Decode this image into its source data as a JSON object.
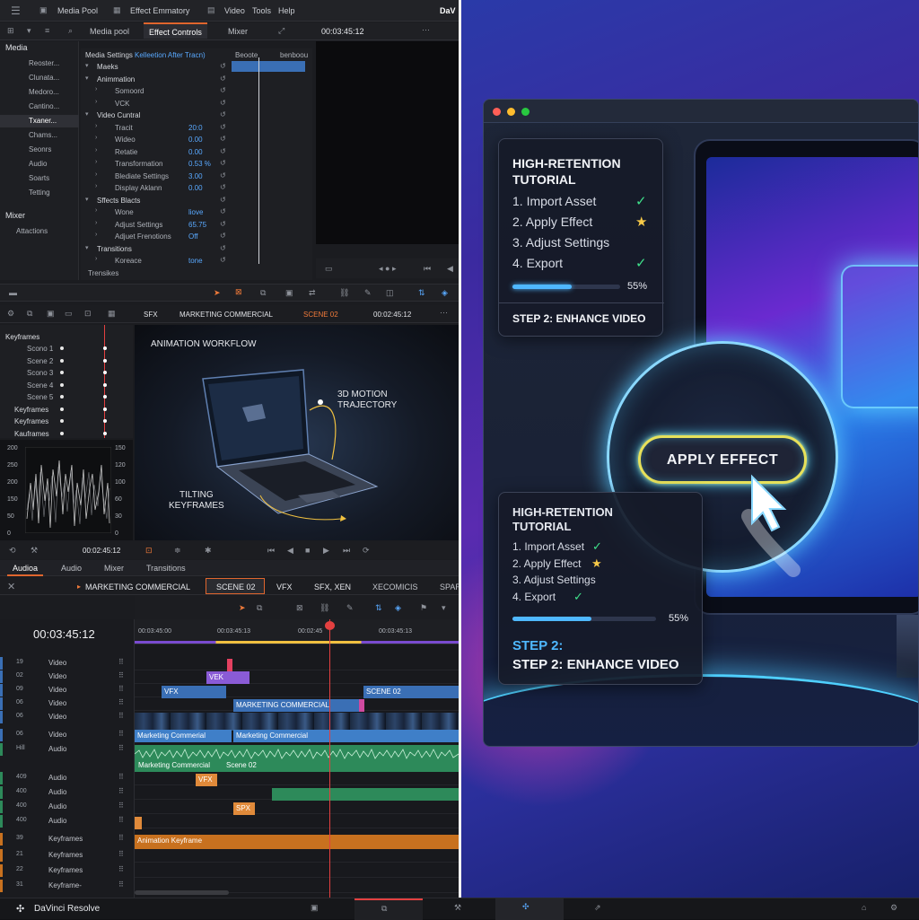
{
  "menubar": {
    "items": [
      "Media Pool",
      "Effect Emmatory",
      "Video",
      "Tools",
      "Help"
    ],
    "app": "DaV"
  },
  "top_tabs": {
    "items": [
      "Media pool",
      "Effect Controls",
      "Mixer"
    ],
    "timecode": "00:03:45:12"
  },
  "media_panel": {
    "header": "Media",
    "items": [
      "Reoster...",
      "Clunata...",
      "Medoro...",
      "Cantino...",
      "Txaner...",
      "Chams...",
      "Seonrs",
      "Audio",
      "Soarts",
      "Tetting"
    ],
    "mixer": "Mixer",
    "mixer_item": "Attactions"
  },
  "effect_controls": {
    "header": "Media Settings",
    "header_sub": "Kelleetion After Tracn)",
    "col2": "Beoote",
    "col3": "benboou",
    "rows": [
      {
        "label": "Maeks",
        "value": ""
      },
      {
        "label": "Animmation",
        "value": ""
      },
      {
        "label": "Somoord",
        "value": ""
      },
      {
        "label": "VCK",
        "value": ""
      },
      {
        "label": "Video Cuntral",
        "value": ""
      },
      {
        "label": "Tracit",
        "value": "20:0"
      },
      {
        "label": "Wideo",
        "value": "0.00"
      },
      {
        "label": "Retatie",
        "value": "0.00"
      },
      {
        "label": "Transformation",
        "value": "0.53 %"
      },
      {
        "label": "Blediate Settings",
        "value": "3.00"
      },
      {
        "label": "Display Aklann",
        "value": "0.00"
      },
      {
        "label": "Sffects Blacts",
        "value": ""
      },
      {
        "label": "Wone",
        "value": "liove"
      },
      {
        "label": "Adjust Settings",
        "value": "65.75"
      },
      {
        "label": "Adjuet Frenotions",
        "value": "Off"
      },
      {
        "label": "Transitions",
        "value": ""
      },
      {
        "label": "Koreace",
        "value": "tone"
      }
    ],
    "footer": "Trensikes"
  },
  "scene_bar": {
    "sfx": "SFX",
    "title": "MARKETING COMMERCIAL",
    "scene": "SCENE 02",
    "timecode": "00:02:45:12"
  },
  "keyframes_panel": {
    "header": "Keyframes",
    "items": [
      "Scono 1",
      "Scene 2",
      "Scono 3",
      "Scene 4",
      "Scene 5",
      "Keyframes",
      "Keyframes",
      "Kauframes"
    ]
  },
  "scope": {
    "left_ticks": [
      "200",
      "250",
      "200",
      "150",
      "50",
      "0"
    ],
    "right_ticks": [
      "150",
      "120",
      "100",
      "60",
      "30",
      "0"
    ]
  },
  "viewer": {
    "title": "ANIMATION WORKFLOW",
    "label_3d": "3D MOTION\nTRAJECTORY",
    "label_tilt": "TILTING\nKEYFRAMES",
    "timecode": "00:02:45:12"
  },
  "page_tabs": {
    "items": [
      "Audioa",
      "Audio",
      "Mixer",
      "Transitions"
    ]
  },
  "timeline_tabs": {
    "items": [
      "MARKETING COMMERCIAL",
      "SCENE 02",
      "VFX",
      "SFX, XEN",
      "XECOMICIS",
      "SPAR"
    ]
  },
  "timeline": {
    "timecode": "00:03:45:12",
    "ruler": [
      "00:03:45:00",
      "00:03:45:13",
      "00:02:45",
      "00:03:45:13"
    ],
    "tracks": [
      {
        "num": "19",
        "name": "Video"
      },
      {
        "num": "02",
        "name": "Video"
      },
      {
        "num": "09",
        "name": "Video"
      },
      {
        "num": "06",
        "name": "Video"
      },
      {
        "num": "06",
        "name": "Video"
      },
      {
        "num": "06",
        "name": "Video"
      },
      {
        "num": "Hill",
        "name": "Audio"
      },
      {
        "num": "",
        "name": ""
      },
      {
        "num": "409",
        "name": "Audio"
      },
      {
        "num": "400",
        "name": "Audio"
      },
      {
        "num": "400",
        "name": "Audio"
      },
      {
        "num": "400",
        "name": "Audio"
      },
      {
        "num": "39",
        "name": "Keyframes"
      },
      {
        "num": "21",
        "name": "Keyframes"
      },
      {
        "num": "22",
        "name": "Keyframes"
      },
      {
        "num": "31",
        "name": "Keyframe-"
      }
    ],
    "clips": {
      "vek": "VEK",
      "vfx1": "VFX",
      "mc1": "MARKETING COMMERCIAL",
      "scene02": "SCENE 02",
      "mc_video1": "Marketing Commerial",
      "mc_video2": "Marketing Commercial",
      "mc_audio": "Marketing Commercial",
      "scene02_audio": "Scene 02",
      "vfx_audio": "VFX",
      "spx": "SPX",
      "anim_kf": "Animation Keyframe"
    }
  },
  "bottom": {
    "app_name": "DaVinci Resolve"
  },
  "artwork": {
    "card1": {
      "title": "HIGH-RETENTION\nTUTORIAL",
      "steps": [
        "1. Import Asset",
        "2. Apply Effect",
        "3. Adjust Settings",
        "4. Export"
      ],
      "progress_label": "55%",
      "progress": 0.55,
      "footer": "STEP 2: ENHANCE VIDEO"
    },
    "button": "APPLY EFFECT",
    "card2": {
      "title": "HIGH-RETENTION\nTUTORIAL",
      "steps": [
        "1. Import Asset",
        "2. Apply Effect",
        "3. Adjust Settings",
        "4. Export"
      ],
      "progress_label": "55%",
      "progress": 0.55,
      "footer1": "STEP 2:",
      "footer2": "STEP 2: ENHANCE VIDEO"
    },
    "colors": {
      "check": "#3fe08a",
      "star": "#f7c948",
      "progress": "#4fb8ff",
      "accent": "#e0662e"
    }
  }
}
